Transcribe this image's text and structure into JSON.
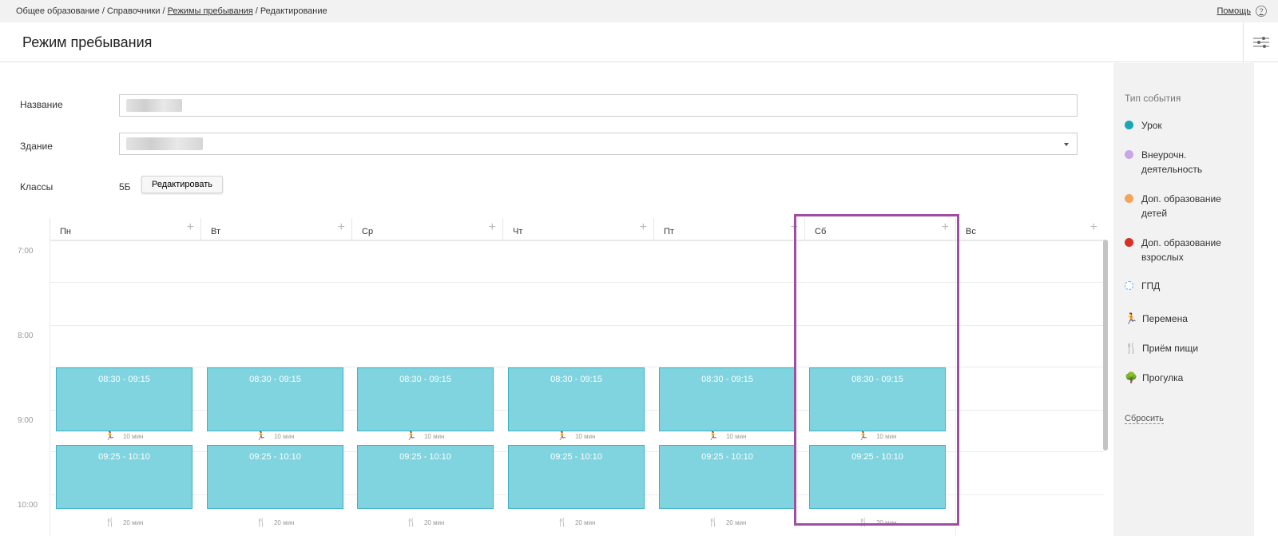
{
  "breadcrumb": {
    "items": [
      "Общее образование",
      "Справочники",
      "Режимы пребывания",
      "Редактирование"
    ],
    "separator": "/"
  },
  "help": {
    "label": "Помощь",
    "icon": "?"
  },
  "page": {
    "title": "Режим пребывания"
  },
  "form": {
    "name_label": "Название",
    "building_label": "Здание",
    "classes_label": "Классы",
    "classes_value": "5Б",
    "edit_label": "Редактировать"
  },
  "schedule": {
    "days": [
      "Пн",
      "Вт",
      "Ср",
      "Чт",
      "Пт",
      "Сб",
      "Вс"
    ],
    "times": [
      "7:00",
      "8:00",
      "9:00",
      "10:00"
    ],
    "lesson1": "08:30 - 09:15",
    "lesson2": "09:25 - 10:10",
    "break1": "10 мин",
    "break2": "20 мин"
  },
  "legend": {
    "title": "Тип события",
    "items": [
      {
        "label": "Урок",
        "color": "#1aa6b7"
      },
      {
        "label": "Внеурочн. деятельность",
        "color": "#c9a6e8"
      },
      {
        "label": "Доп. образование детей",
        "color": "#f5a55a"
      },
      {
        "label": "Доп. образование взрослых",
        "color": "#d93025"
      },
      {
        "label": "ГПД",
        "color": "#5fb0e8"
      }
    ],
    "icons": [
      {
        "label": "Перемена",
        "icon": "running-icon"
      },
      {
        "label": "Приём пищи",
        "icon": "fork-knife-icon"
      },
      {
        "label": "Прогулка",
        "icon": "tree-icon"
      }
    ],
    "reset": "Сбросить"
  },
  "colors": {
    "lesson_fill": "#7fd4df",
    "lesson_border": "#3cb2c4",
    "highlight": "#a04ea3"
  }
}
